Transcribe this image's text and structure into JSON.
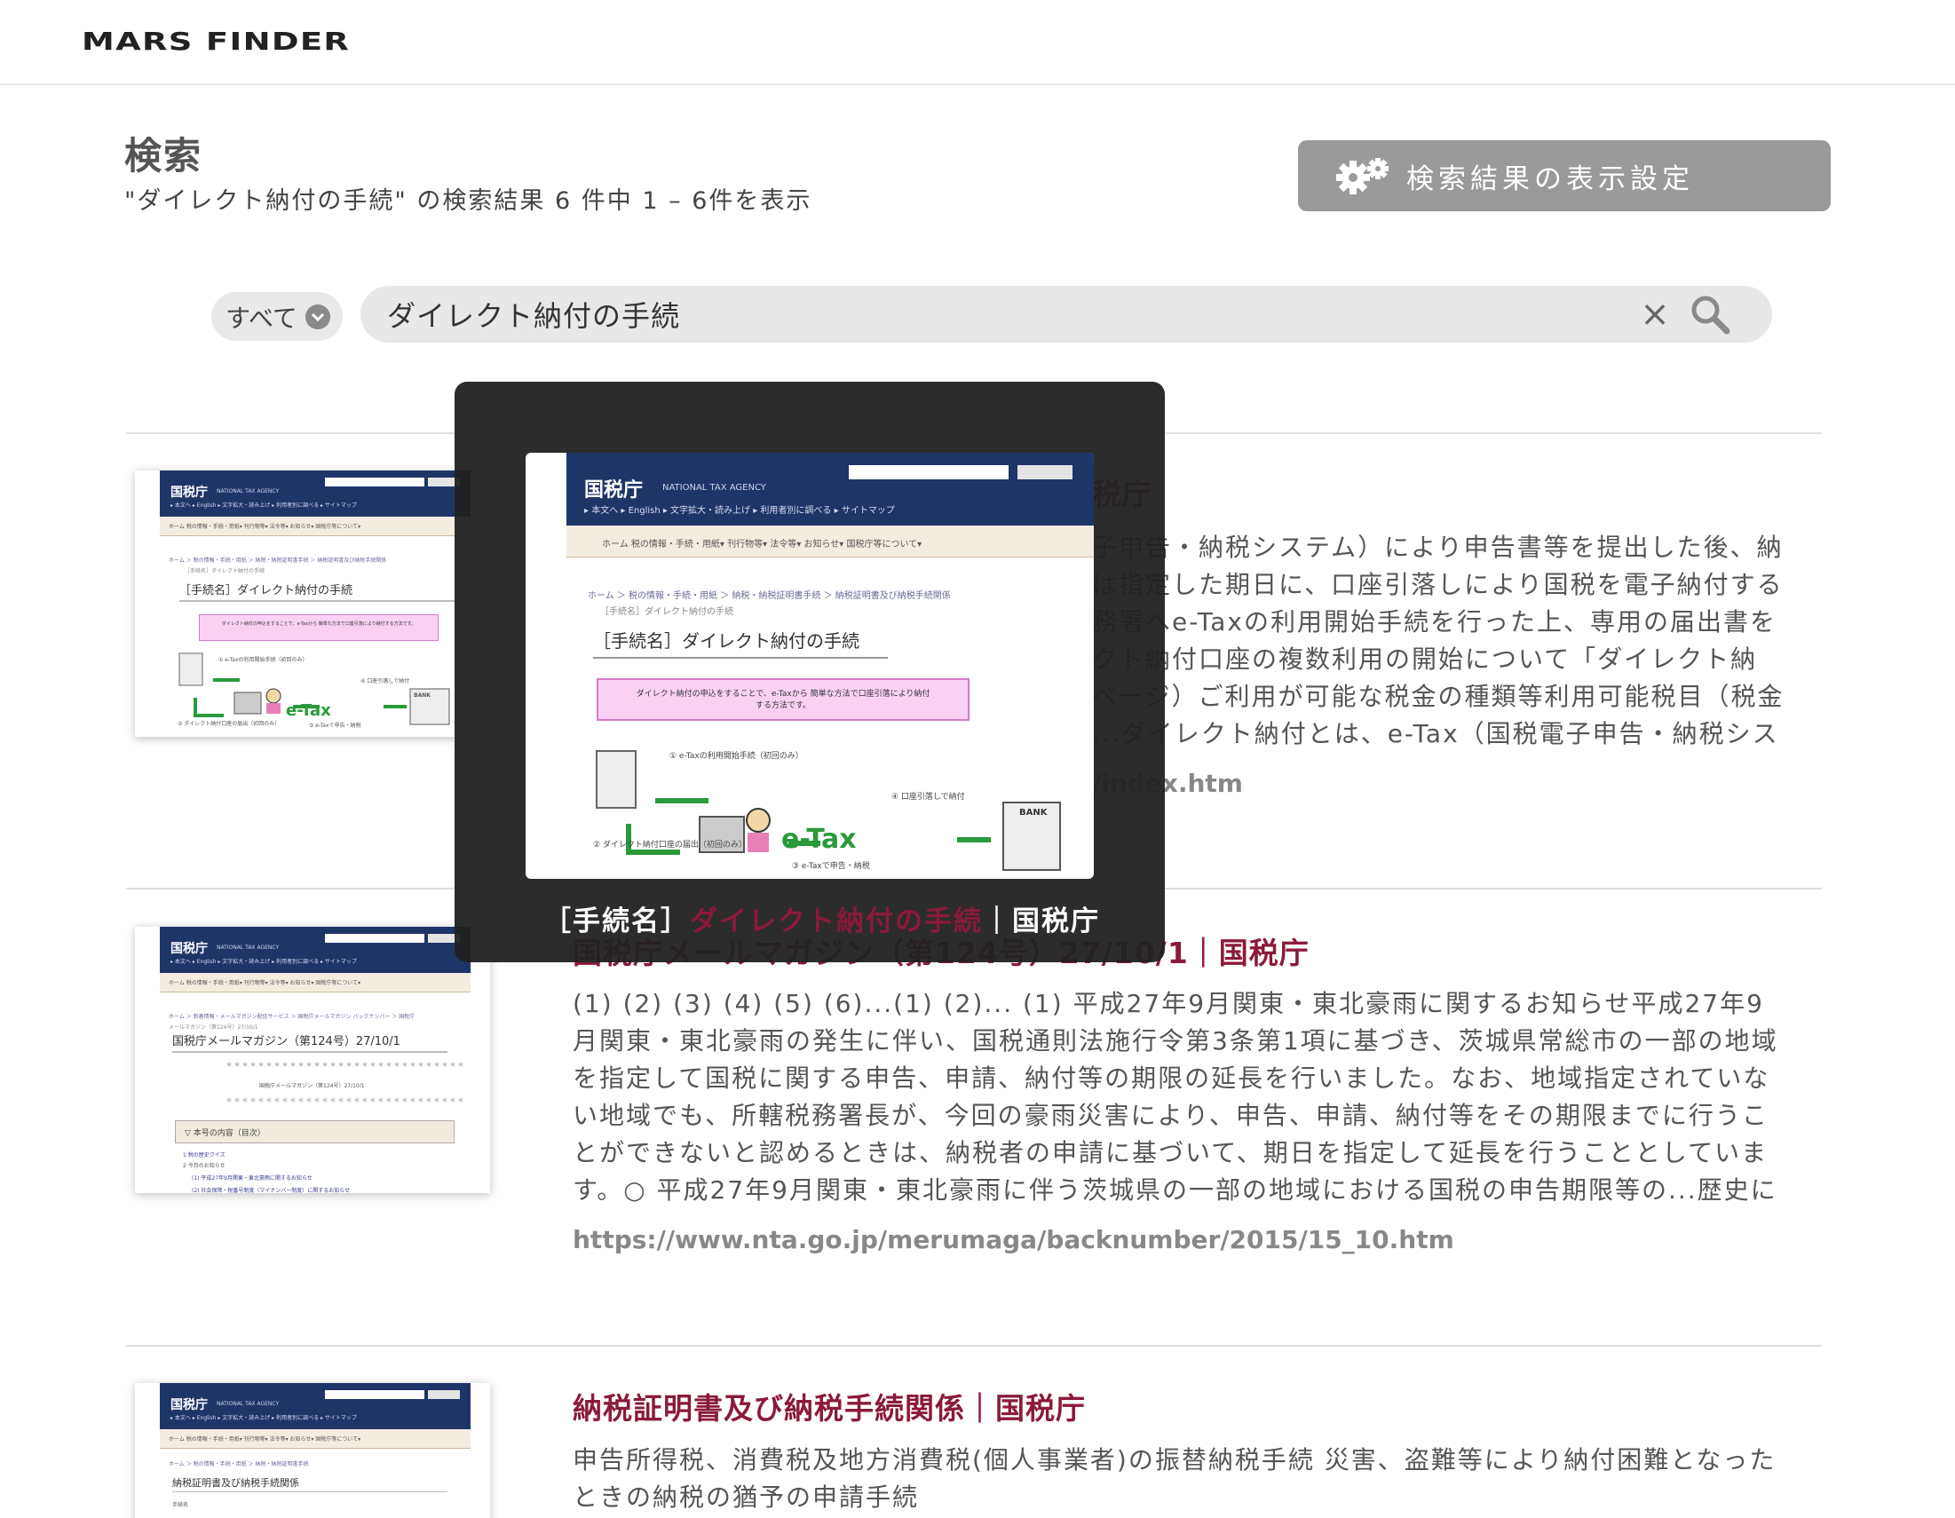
{
  "header": {
    "logo": "MARS FINDER"
  },
  "page": {
    "title": "検索",
    "summary": "\"ダイレクト納付の手続\" の検索結果 6 件中 1 – 6件を表示",
    "settings_label": "検索結果の表示設定"
  },
  "search": {
    "scope": "すべて",
    "query": "ダイレクト納付の手続",
    "clear": "×"
  },
  "results": [
    {
      "title": "［手続名］ダイレクト納付の手続｜国税庁",
      "visible_title": "税庁",
      "snippet_lines": [
        "子申告・納税システム）により申告書等を提出した後、納",
        "は指定した期日に、口座引落しにより国税を電子納付する",
        "務署へe-Taxの利用開始手続を行った上、専用の届出書を",
        "クト納付口座の複数利用の開始について「ダイレクト納",
        "ページ）ご利用が可能な税金の種類等利用可能税目（税金",
        "...ダイレクト納付とは、e-Tax（国税電子申告・納税シス"
      ],
      "url": "/index.htm"
    },
    {
      "title": "国税庁メールマガジン（第124号）27/10/1｜国税庁",
      "snippet_lines": [
        "(1) (2) (3) (4) (5) (6)...(1) (2)... (1)  平成27年9月関東・東北豪雨に関するお知らせ平成27年9",
        "月関東・東北豪雨の発生に伴い、国税通則法施行令第3条第1項に基づき、茨城県常総市の一部の地域",
        "を指定して国税に関する申告、申請、納付等の期限の延長を行いました。なお、地域指定されていな",
        "い地域でも、所轄税務署長が、今回の豪雨災害により、申告、申請、納付等をその期限までに行うこ",
        "とができないと認めるときは、納税者の申請に基づいて、期日を指定して延長を行うこととしていま",
        "す。○  平成27年9月関東・東北豪雨に伴う茨城県の一部の地域における国税の申告期限等の...歴史に"
      ],
      "url": "https://www.nta.go.jp/merumaga/backnumber/2015/15_10.htm"
    },
    {
      "title": "納税証明書及び納税手続関係｜国税庁",
      "snippet_lines": [
        "申告所得税、消費税及地方消費税(個人事業者)の振替納税手続 災害、盗難等により納付困難となった",
        "ときの納税の猶予の申請手続"
      ]
    }
  ],
  "preview": {
    "caption_prefix": "［手続名］",
    "caption_highlight": "ダイレクト納付の手続",
    "caption_suffix": "｜国税庁"
  },
  "thumbs": {
    "site_name": "国税庁",
    "site_en": "NATIONAL TAX AGENCY",
    "search_btn": "検索",
    "nav": "▸ 本文へ  ▸ English  ▸ 文字拡大・読み上げ  ▸ 利用者別に調べる  ▸ サイトマップ",
    "menu": "ホーム   税の情報・手続・用紙▾   刊行物等▾   法令等▾   お知らせ▾   国税庁等について▾",
    "t1_crumb": "ホーム ＞ 税の情報・手続・用紙 ＞ 納税・納税証明書手続 ＞ 納税証明書及び納税手続関係",
    "t1_crumb2": "［手続名］ダイレクト納付の手続",
    "t1_h1": "［手続名］ダイレクト納付の手続",
    "t1_pink": "ダイレクト納付の申込をすることで、e-Taxから 簡単な方法で口座引落により納付する方法です。",
    "t1_etax": "e-Tax",
    "t1_bank": "BANK",
    "t1_step1": "① e-Taxの利用開始手続（初回のみ）",
    "t1_step2": "② ダイレクト納付口座の届出（初回のみ）",
    "t1_step3": "③ e-Taxで申告・納税",
    "t1_step4": "④ 口座引落しで納付",
    "t2_crumb": "ホーム ＞ 新着情報・メールマガジン配信サービス ＞ 国税庁メールマガジン バックナンバー ＞ 国税庁",
    "t2_crumb2": "メールマガジン（第124号）27/10/1",
    "t2_h1": "国税庁メールマガジン（第124号）27/10/1",
    "t2_stars": "＊＊＊＊＊＊＊＊＊＊＊＊＊＊＊＊＊＊＊＊＊＊＊＊＊＊＊＊＊＊",
    "t2_mid": "国税庁メールマガジン（第124号）27/10/1",
    "t2_box": "▽ 本号の内容（目次）",
    "t2_l1": "1  税の歴史クイズ",
    "t2_l2": "2  今月のお知らせ",
    "t2_l3": "(1)  平成27年9月関東・東北豪雨に関するお知らせ",
    "t2_l4": "(2)  社会保障・税番号制度（マイナンバー制度）に関するお知らせ",
    "t3_crumb": "ホーム ＞ 税の情報・手続・用紙 ＞ 納税・納税証明書手続",
    "t3_h1": "納税証明書及び納税手続関係",
    "t3_sub": "手続名"
  },
  "colors": {
    "accent": "#8b1a3a",
    "button_gray": "#9a9a9a",
    "overlay": "#212121"
  }
}
